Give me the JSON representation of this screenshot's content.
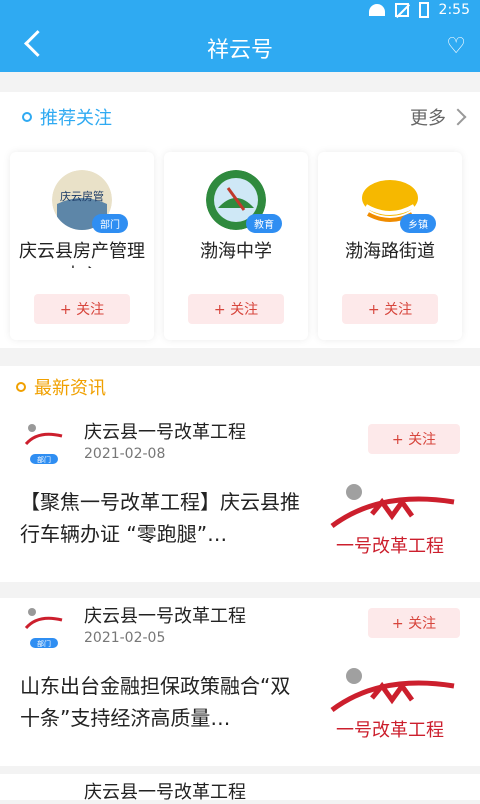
{
  "status_bar": {
    "time": "2:55"
  },
  "header": {
    "title": "祥云号"
  },
  "recommend": {
    "title": "推荐关注",
    "more_label": "更多",
    "items": [
      {
        "name": "庆云县房产管理中心",
        "badge": "部门",
        "follow_label": "+ 关注"
      },
      {
        "name": "渤海中学",
        "badge": "教育",
        "follow_label": "+ 关注"
      },
      {
        "name": "渤海路街道",
        "badge": "乡镇",
        "follow_label": "+ 关注"
      }
    ]
  },
  "news": {
    "title": "最新资讯",
    "items": [
      {
        "source": "庆云县一号改革工程",
        "date": "2021-02-08",
        "badge": "部门",
        "follow_label": "+ 关注",
        "headline": "【聚焦一号改革工程】庆云县推行车辆办证 “零跑腿”…",
        "thumb_text": "一号改革工程"
      },
      {
        "source": "庆云县一号改革工程",
        "date": "2021-02-05",
        "badge": "部门",
        "follow_label": "+ 关注",
        "headline": "山东出台金融担保政策融合“双十条”支持经济高质量…",
        "thumb_text": "一号改革工程"
      },
      {
        "source": "庆云县一号改革工程",
        "date": "",
        "badge": "",
        "follow_label": "",
        "headline": "",
        "thumb_text": ""
      }
    ]
  },
  "colors": {
    "header": "#2faaf2",
    "follow_bg": "#fde9ea",
    "follow_text": "#d7453c",
    "news_accent": "#f0a000"
  }
}
